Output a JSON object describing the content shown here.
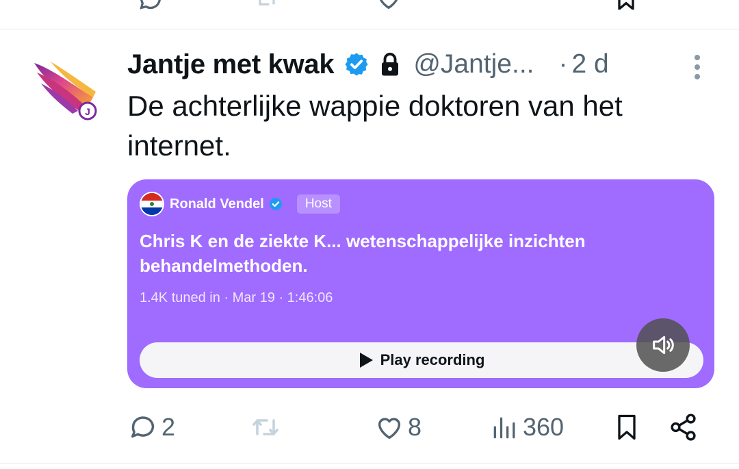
{
  "tweet": {
    "author_name": "Jantje met kwak",
    "handle": "@Jantje...",
    "separator": "·",
    "time": "2 d",
    "text": "De achterlijke wappie doktoren van het internet."
  },
  "space": {
    "host_name": "Ronald Vendel",
    "host_badge": "Host",
    "title": "Chris K en de ziekte K... wetenschappelijke inzichten behandelmethoden.",
    "meta": "1.4K tuned in · Mar 19 · 1:46:06",
    "play_label": "Play recording",
    "card_color": "#a06bff"
  },
  "actions": {
    "replies": "2",
    "reposts": "",
    "likes": "8",
    "views": "360"
  },
  "colors": {
    "verified": "#1d9bf0",
    "muted_text": "#536471",
    "repost_icon": "#c6d3dc"
  },
  "icons": {
    "reply": "reply-icon",
    "repost": "repost-icon",
    "like": "heart-icon",
    "views": "views-icon",
    "bookmark": "bookmark-icon",
    "share": "share-icon",
    "more": "more-icon",
    "lock": "lock-icon",
    "verified": "verified-icon",
    "mute": "speaker-icon",
    "play": "play-icon"
  }
}
